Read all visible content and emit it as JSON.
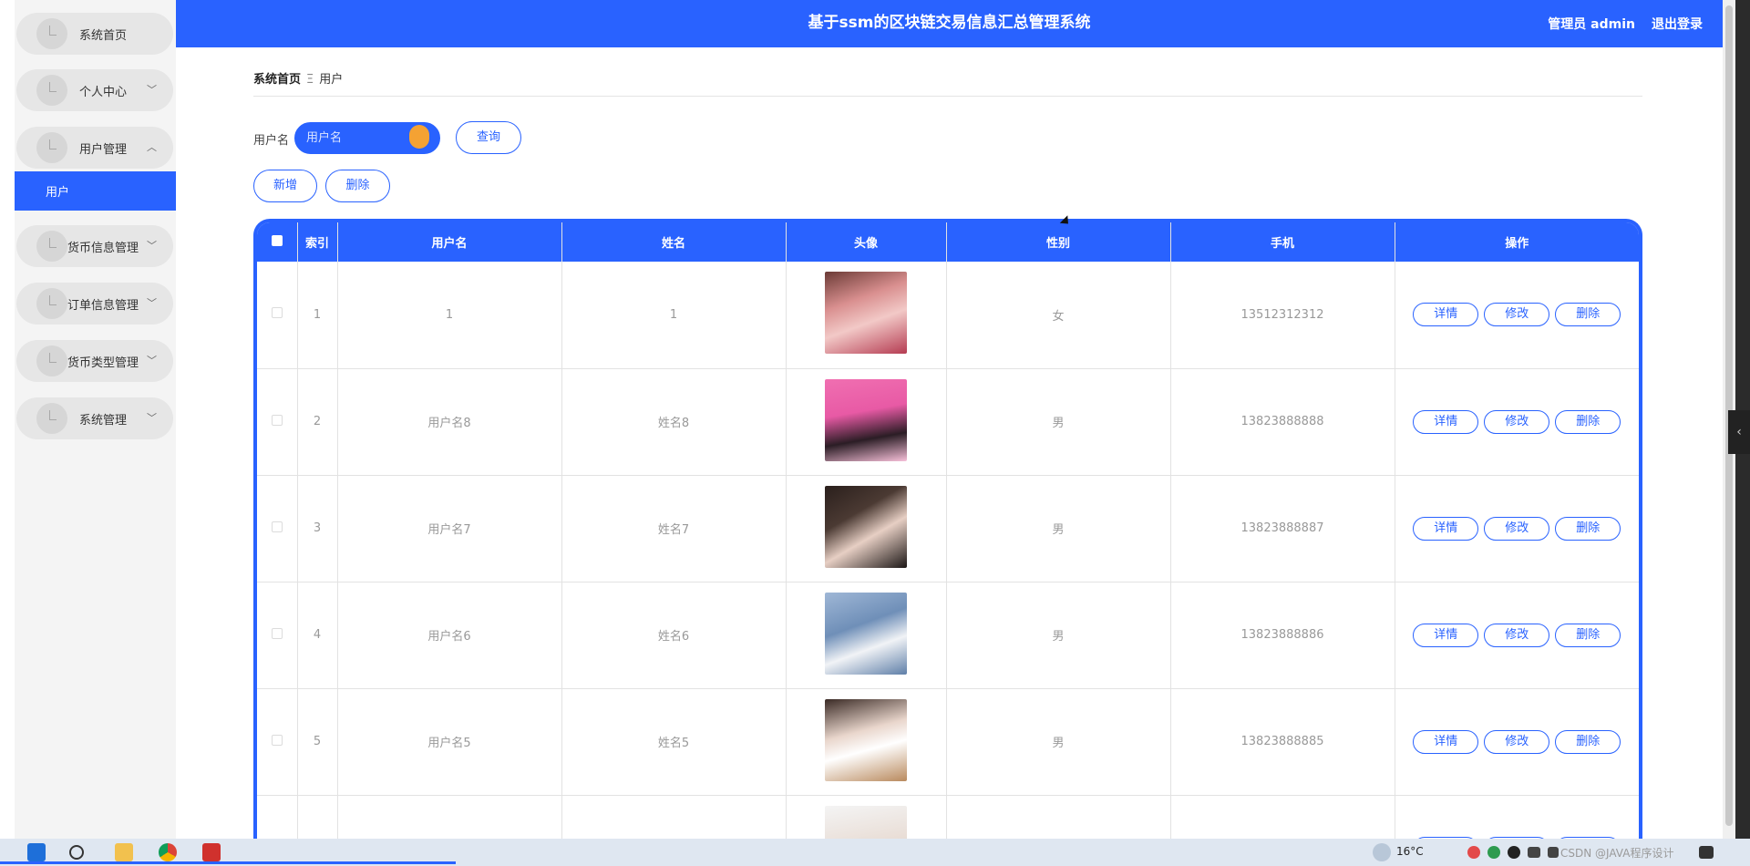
{
  "header": {
    "title": "基于ssm的区块链交易信息汇总管理系统",
    "user": "管理员 admin",
    "logout": "退出登录"
  },
  "sidebar": {
    "items": [
      {
        "label": "系统首页"
      },
      {
        "label": "个人中心"
      },
      {
        "label": "用户管理"
      },
      {
        "label": "货币信息管理"
      },
      {
        "label": "订单信息管理"
      },
      {
        "label": "货币类型管理"
      },
      {
        "label": "系统管理"
      }
    ],
    "submenu_active": "用户"
  },
  "breadcrumb": {
    "home": "系统首页",
    "separator": "Ξ",
    "current": "用户"
  },
  "search": {
    "label": "用户名",
    "placeholder": "用户名",
    "query_button": "查询"
  },
  "actions": {
    "add": "新增",
    "delete": "删除"
  },
  "table": {
    "columns": [
      "索引",
      "用户名",
      "姓名",
      "头像",
      "性别",
      "手机",
      "操作"
    ],
    "rows": [
      {
        "index": "1",
        "username": "1",
        "name": "1",
        "gender": "女",
        "phone": "13512312312"
      },
      {
        "index": "2",
        "username": "用户名8",
        "name": "姓名8",
        "gender": "男",
        "phone": "13823888888"
      },
      {
        "index": "3",
        "username": "用户名7",
        "name": "姓名7",
        "gender": "男",
        "phone": "13823888887"
      },
      {
        "index": "4",
        "username": "用户名6",
        "name": "姓名6",
        "gender": "男",
        "phone": "13823888886"
      },
      {
        "index": "5",
        "username": "用户名5",
        "name": "姓名5",
        "gender": "男",
        "phone": "13823888885"
      },
      {
        "index": "",
        "username": "",
        "name": "",
        "gender": "",
        "phone": ""
      }
    ],
    "row_actions": {
      "detail": "详情",
      "edit": "修改",
      "delete": "删除"
    }
  },
  "taskbar": {
    "weather": "16°C",
    "watermark": "CSDN @JAVA程序设计"
  },
  "colors": {
    "primary": "#2962ff",
    "sidebar_bg": "#f4f4f4",
    "menu_item_bg": "#e6e6e6"
  }
}
